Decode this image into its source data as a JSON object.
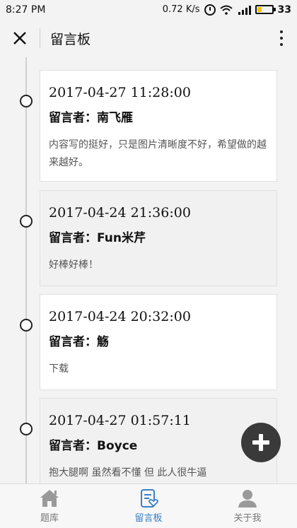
{
  "status_bar": {
    "time": "8:27 PM",
    "speed": "0.72 K/s",
    "battery_level": "33"
  },
  "header": {
    "title": "留言板",
    "close_icon": "close-icon",
    "more_icon": "more-vertical-icon"
  },
  "messages": [
    {
      "date": "2017-04-27 11:28:00",
      "author": "留言者：南飞雁",
      "text": "内容写的挺好，只是图片清晰度不好，希望做的越来越好。"
    },
    {
      "date": "2017-04-24 21:36:00",
      "author": "留言者：Fun米芹",
      "text": "好棒好棒！"
    },
    {
      "date": "2017-04-24 20:32:00",
      "author": "留言者：觞",
      "text": "下载"
    },
    {
      "date": "2017-04-27 01:57:11",
      "author": "留言者：Boyce",
      "text": "抱大腿啊 虽然看不懂 但 此人很牛逼"
    }
  ],
  "fab": {
    "icon": "plus-icon"
  },
  "bottom_nav": [
    {
      "label": "题库",
      "icon": "home-icon",
      "active": false
    },
    {
      "label": "留言板",
      "icon": "message-board-icon",
      "active": true
    },
    {
      "label": "关于我",
      "icon": "user-icon",
      "active": false
    }
  ],
  "colors": {
    "accent": "#3a7fc9",
    "fab": "#3a3a3a",
    "battery": "#f5c400"
  }
}
